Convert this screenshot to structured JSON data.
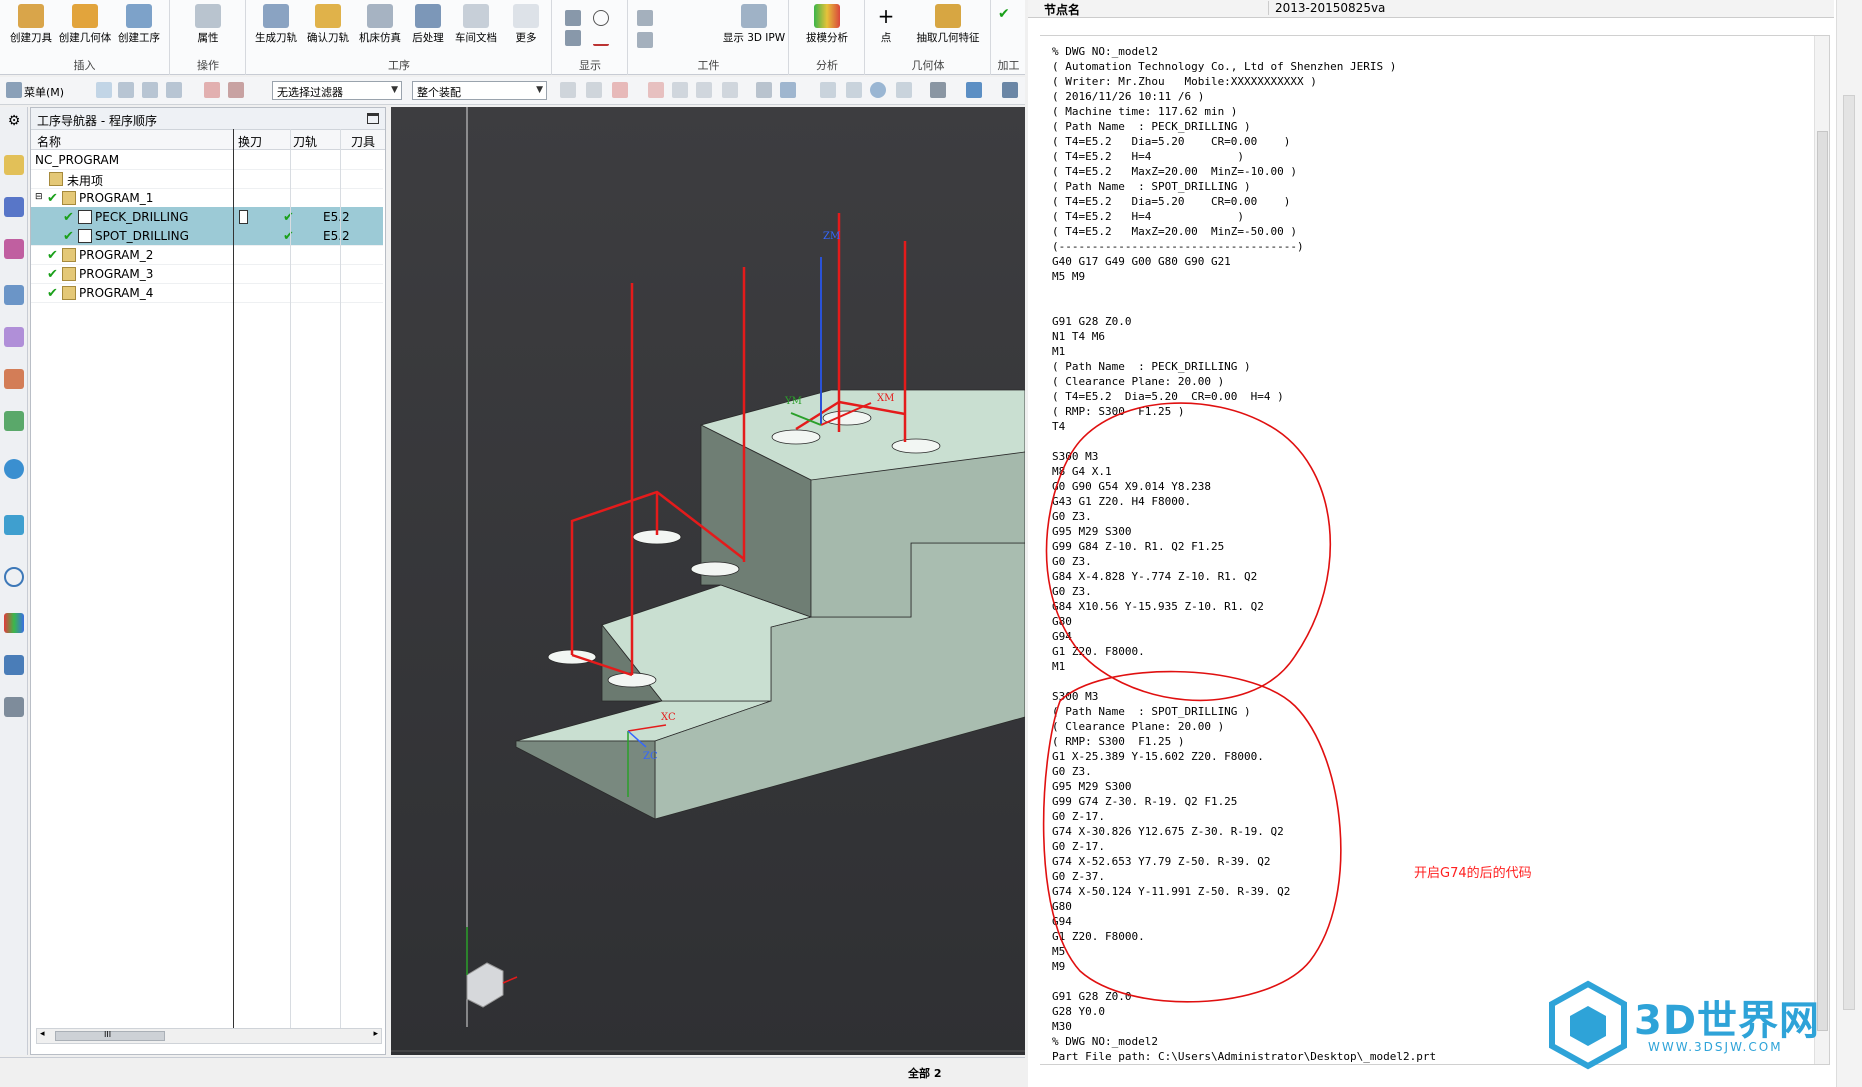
{
  "ribbon": {
    "groups": [
      {
        "label": "插入",
        "buttons": [
          "创建刀具",
          "创建几何体",
          "创建工序"
        ]
      },
      {
        "label": "操作",
        "buttons": [
          "属性"
        ]
      },
      {
        "label": "工序",
        "buttons": [
          "生成刀轨",
          "确认刀轨",
          "机床仿真",
          "后处理",
          "车间文档",
          "更多"
        ]
      },
      {
        "label": "显示",
        "buttons": []
      },
      {
        "label": "工件",
        "buttons": [
          "显示 3D IPW"
        ]
      },
      {
        "label": "分析",
        "buttons": [
          "拔模分析"
        ]
      },
      {
        "label": "几何体",
        "buttons": [
          "点",
          "抽取几何特征"
        ]
      },
      {
        "label": "加工",
        "buttons": []
      }
    ]
  },
  "toolbar2": {
    "menu_label": "菜单(M)",
    "filter_value": "无选择过滤器",
    "assembly_value": "整个装配"
  },
  "navigator": {
    "title": "工序导航器 - 程序顺序",
    "columns": [
      "名称",
      "换刀",
      "刀轨",
      "刀具"
    ],
    "rows": [
      {
        "name": "NC_PROGRAM",
        "change": "",
        "path": "",
        "tool": ""
      },
      {
        "name": "未用项",
        "change": "",
        "path": "",
        "tool": ""
      },
      {
        "name": "PROGRAM_1",
        "change": "",
        "path": "",
        "tool": ""
      },
      {
        "name": "PECK_DRILLING",
        "change": "",
        "path": "✔",
        "tool": "E5.2"
      },
      {
        "name": "SPOT_DRILLING",
        "change": "",
        "path": "✔",
        "tool": "E5.2"
      },
      {
        "name": "PROGRAM_2",
        "change": "",
        "path": "",
        "tool": ""
      },
      {
        "name": "PROGRAM_3",
        "change": "",
        "path": "",
        "tool": ""
      },
      {
        "name": "PROGRAM_4",
        "change": "",
        "path": "",
        "tool": ""
      }
    ],
    "scroll_label": "III"
  },
  "viewport": {
    "axis_labels": {
      "zm": "ZM",
      "ym": "YM",
      "xm": "XM",
      "xc": "XC",
      "zc": "ZC",
      "yc": "YC"
    }
  },
  "status": {
    "text": "全部 2"
  },
  "properties": {
    "key": "节点名",
    "value": "2013-20150825va"
  },
  "code": {
    "text": "% DWG NO:_model2\n( Automation Technology Co., Ltd of Shenzhen JERIS )\n( Writer: Mr.Zhou   Mobile:XXXXXXXXXXX )\n( 2016/11/26 10:11 /6 )\n( Machine time: 117.62 min )\n( Path Name  : PECK_DRILLING )\n( T4=E5.2   Dia=5.20    CR=0.00    )\n( T4=E5.2   H=4             )\n( T4=E5.2   MaxZ=20.00  MinZ=-10.00 )\n( Path Name  : SPOT_DRILLING )\n( T4=E5.2   Dia=5.20    CR=0.00    )\n( T4=E5.2   H=4             )\n( T4=E5.2   MaxZ=20.00  MinZ=-50.00 )\n(------------------------------------)\nG40 G17 G49 G00 G80 G90 G21\nM5 M9\n\n\nG91 G28 Z0.0\nN1 T4 M6\nM1\n( Path Name  : PECK_DRILLING )\n( Clearance Plane: 20.00 )\n( T4=E5.2  Dia=5.20  CR=0.00  H=4 )\n( RMP: S300  F1.25 )\nT4\n\nS300 M3\nM8 G4 X.1\nG0 G90 G54 X9.014 Y8.238\nG43 G1 Z20. H4 F8000.\nG0 Z3.\nG95 M29 S300\nG99 G84 Z-10. R1. Q2 F1.25\nG0 Z3.\nG84 X-4.828 Y-.774 Z-10. R1. Q2\nG0 Z3.\nG84 X10.56 Y-15.935 Z-10. R1. Q2\nG80\nG94\nG1 Z20. F8000.\nM1\n\nS300 M3\n( Path Name  : SPOT_DRILLING )\n( Clearance Plane: 20.00 )\n( RMP: S300  F1.25 )\nG1 X-25.389 Y-15.602 Z20. F8000.\nG0 Z3.\nG95 M29 S300\nG99 G74 Z-30. R-19. Q2 F1.25\nG0 Z-17.\nG74 X-30.826 Y12.675 Z-30. R-19. Q2\nG0 Z-17.\nG74 X-52.653 Y7.79 Z-50. R-39. Q2\nG0 Z-37.\nG74 X-50.124 Y-11.991 Z-50. R-39. Q2\nG80\nG94\nG1 Z20. F8000.\nM5\nM9\n\nG91 G28 Z0.0\nG28 Y0.0\nM30\n% DWG NO:_model2\nPart File path: C:\\Users\\Administrator\\Desktop\\_model2.prt",
    "annotation": "开启G74的后的代码"
  },
  "watermark": {
    "title": "3D世界网",
    "url": "WWW.3DSJW.COM"
  },
  "colors": {
    "selection": "#9ccad6",
    "check": "#1aa01a",
    "toolpath": "#e41b1b",
    "part_top": "#c9dfd1",
    "annotation": "#ff2020"
  }
}
